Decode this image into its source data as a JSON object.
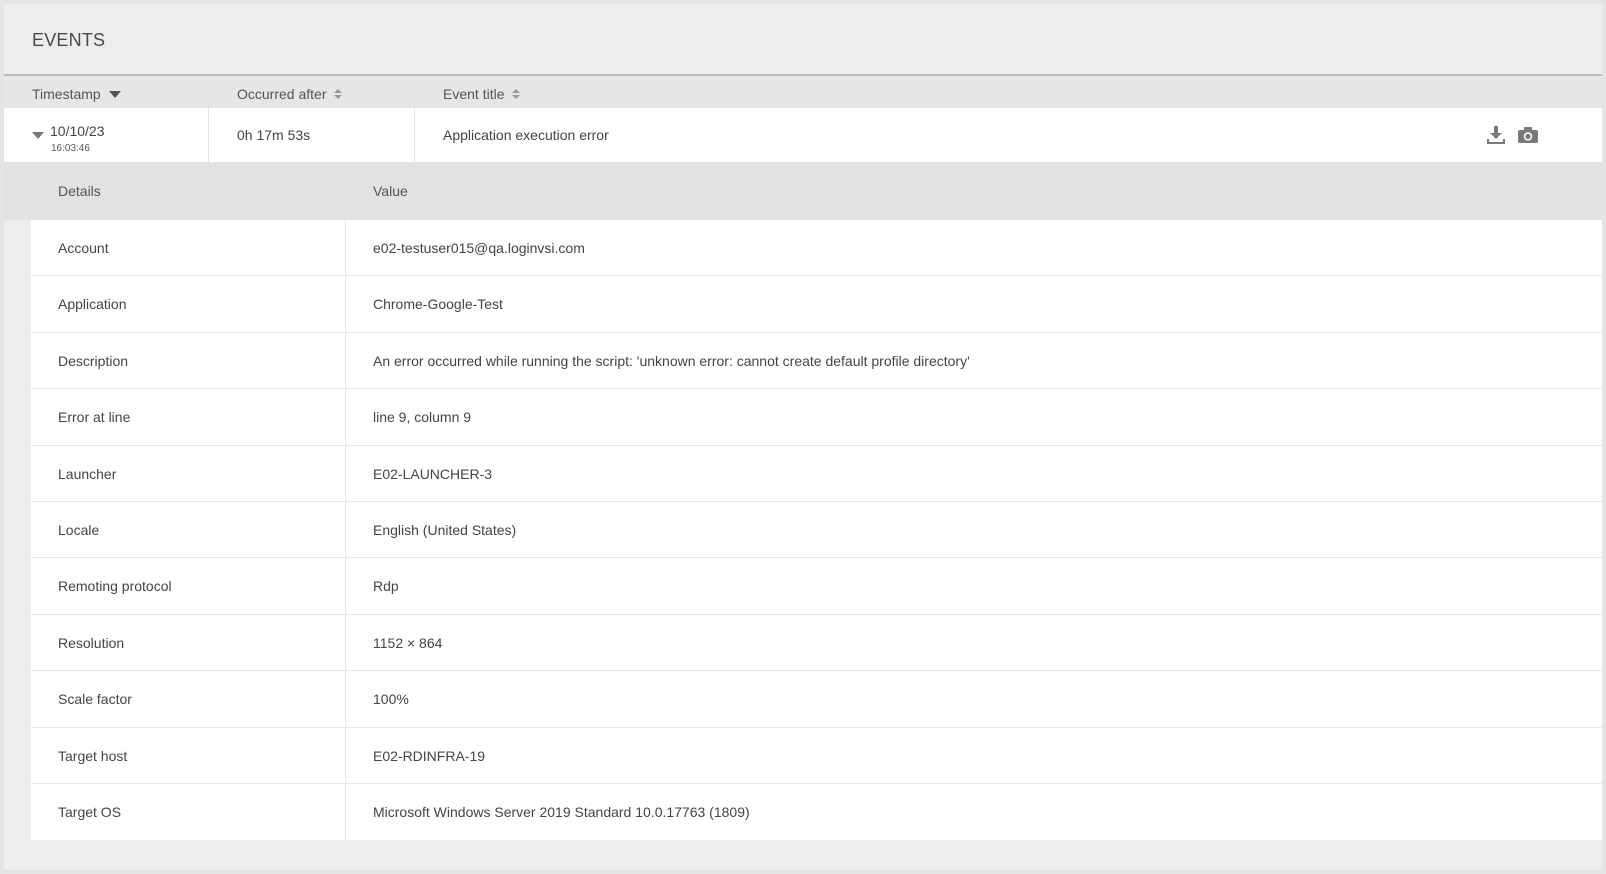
{
  "panel": {
    "title": "EVENTS"
  },
  "columns": {
    "timestamp": "Timestamp",
    "occurred_after": "Occurred after",
    "event_title": "Event title"
  },
  "event": {
    "date": "10/10/23",
    "time": "16:03:46",
    "occurred_after": "0h 17m 53s",
    "title": "Application execution error",
    "actions": [
      "download-icon",
      "camera-icon"
    ]
  },
  "details": {
    "header_key": "Details",
    "header_value": "Value",
    "rows": [
      {
        "key": "Account",
        "value": "e02-testuser015@qa.loginvsi.com"
      },
      {
        "key": "Application",
        "value": "Chrome-Google-Test"
      },
      {
        "key": "Description",
        "value": "An error occurred while running the script: 'unknown error: cannot create default profile directory'"
      },
      {
        "key": "Error at line",
        "value": "line 9, column 9"
      },
      {
        "key": "Launcher",
        "value": "E02-LAUNCHER-3"
      },
      {
        "key": "Locale",
        "value": "English (United States)"
      },
      {
        "key": "Remoting protocol",
        "value": "Rdp"
      },
      {
        "key": "Resolution",
        "value": "1152 × 864"
      },
      {
        "key": "Scale factor",
        "value": "100%"
      },
      {
        "key": "Target host",
        "value": "E02-RDINFRA-19"
      },
      {
        "key": "Target OS",
        "value": "Microsoft Windows Server 2019 Standard 10.0.17763 (1809)"
      }
    ]
  },
  "colors": {
    "page_bg": "#e4e4e4",
    "panel_bg": "#ededed",
    "row_bg": "#ffffff",
    "text": "#444444"
  }
}
